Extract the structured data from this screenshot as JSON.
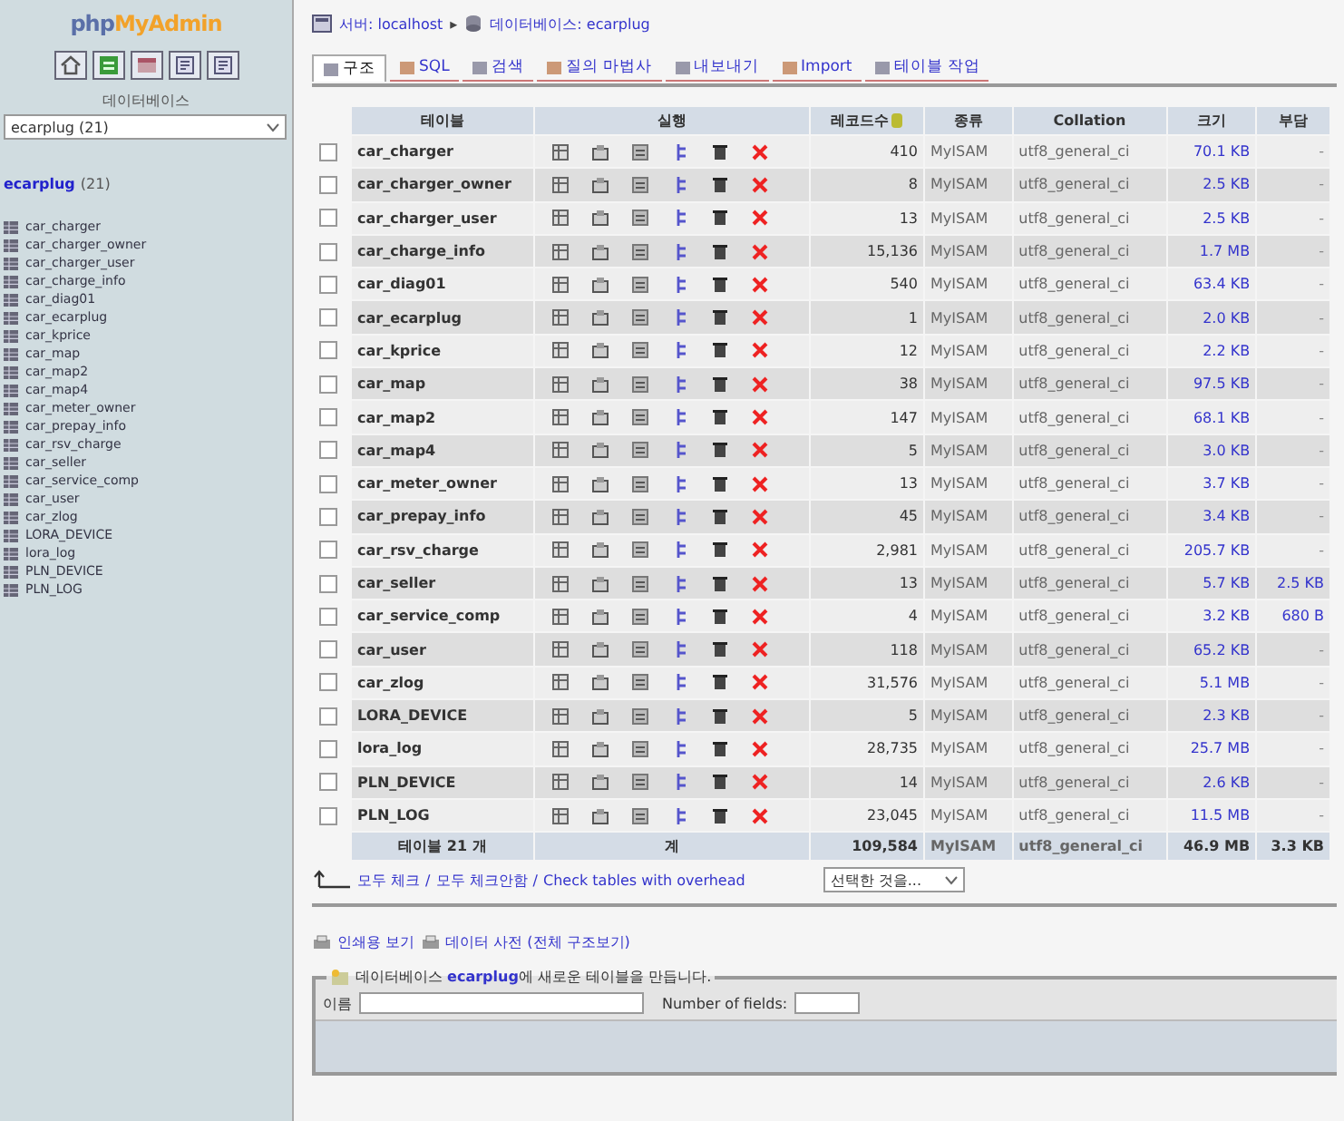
{
  "sidebar": {
    "logo_parts": [
      "php",
      "MyAdmin"
    ],
    "db_label": "데이터베이스",
    "db_select": "ecarplug (21)",
    "db_link": "ecarplug",
    "db_count": "(21)",
    "tables": [
      "car_charger",
      "car_charger_owner",
      "car_charger_user",
      "car_charge_info",
      "car_diag01",
      "car_ecarplug",
      "car_kprice",
      "car_map",
      "car_map2",
      "car_map4",
      "car_meter_owner",
      "car_prepay_info",
      "car_rsv_charge",
      "car_seller",
      "car_service_comp",
      "car_user",
      "car_zlog",
      "LORA_DEVICE",
      "lora_log",
      "PLN_DEVICE",
      "PLN_LOG"
    ]
  },
  "breadcrumb": {
    "server": "서버: localhost",
    "separator": "▸",
    "database": "데이터베이스: ecarplug"
  },
  "tabs": [
    {
      "label": "구조",
      "selected": true
    },
    {
      "label": "SQL",
      "selected": false
    },
    {
      "label": "검색",
      "selected": false
    },
    {
      "label": "질의 마법사",
      "selected": false
    },
    {
      "label": "내보내기",
      "selected": false
    },
    {
      "label": "Import",
      "selected": false
    },
    {
      "label": "테이블 작업",
      "selected": false
    }
  ],
  "table": {
    "columns": [
      "테이블",
      "실행",
      "레코드수",
      "종류",
      "Collation",
      "크기",
      "부담"
    ],
    "rows": [
      {
        "checked": false,
        "name": "car_charger",
        "records": "410",
        "type": "MyISAM",
        "collation": "utf8_general_ci",
        "size": "70.1 KB",
        "overhead": "-"
      },
      {
        "checked": false,
        "name": "car_charger_owner",
        "records": "8",
        "type": "MyISAM",
        "collation": "utf8_general_ci",
        "size": "2.5 KB",
        "overhead": "-"
      },
      {
        "checked": false,
        "name": "car_charger_user",
        "records": "13",
        "type": "MyISAM",
        "collation": "utf8_general_ci",
        "size": "2.5 KB",
        "overhead": "-"
      },
      {
        "checked": false,
        "name": "car_charge_info",
        "records": "15,136",
        "type": "MyISAM",
        "collation": "utf8_general_ci",
        "size": "1.7 MB",
        "overhead": "-"
      },
      {
        "checked": false,
        "name": "car_diag01",
        "records": "540",
        "type": "MyISAM",
        "collation": "utf8_general_ci",
        "size": "63.4 KB",
        "overhead": "-"
      },
      {
        "checked": false,
        "name": "car_ecarplug",
        "records": "1",
        "type": "MyISAM",
        "collation": "utf8_general_ci",
        "size": "2.0 KB",
        "overhead": "-"
      },
      {
        "checked": false,
        "name": "car_kprice",
        "records": "12",
        "type": "MyISAM",
        "collation": "utf8_general_ci",
        "size": "2.2 KB",
        "overhead": "-"
      },
      {
        "checked": false,
        "name": "car_map",
        "records": "38",
        "type": "MyISAM",
        "collation": "utf8_general_ci",
        "size": "97.5 KB",
        "overhead": "-"
      },
      {
        "checked": false,
        "name": "car_map2",
        "records": "147",
        "type": "MyISAM",
        "collation": "utf8_general_ci",
        "size": "68.1 KB",
        "overhead": "-"
      },
      {
        "checked": false,
        "name": "car_map4",
        "records": "5",
        "type": "MyISAM",
        "collation": "utf8_general_ci",
        "size": "3.0 KB",
        "overhead": "-"
      },
      {
        "checked": false,
        "name": "car_meter_owner",
        "records": "13",
        "type": "MyISAM",
        "collation": "utf8_general_ci",
        "size": "3.7 KB",
        "overhead": "-"
      },
      {
        "checked": false,
        "name": "car_prepay_info",
        "records": "45",
        "type": "MyISAM",
        "collation": "utf8_general_ci",
        "size": "3.4 KB",
        "overhead": "-"
      },
      {
        "checked": false,
        "name": "car_rsv_charge",
        "records": "2,981",
        "type": "MyISAM",
        "collation": "utf8_general_ci",
        "size": "205.7 KB",
        "overhead": "-"
      },
      {
        "checked": false,
        "name": "car_seller",
        "records": "13",
        "type": "MyISAM",
        "collation": "utf8_general_ci",
        "size": "5.7 KB",
        "overhead": "2.5 KB"
      },
      {
        "checked": false,
        "name": "car_service_comp",
        "records": "4",
        "type": "MyISAM",
        "collation": "utf8_general_ci",
        "size": "3.2 KB",
        "overhead": "680 B"
      },
      {
        "checked": false,
        "name": "car_user",
        "records": "118",
        "type": "MyISAM",
        "collation": "utf8_general_ci",
        "size": "65.2 KB",
        "overhead": "-"
      },
      {
        "checked": false,
        "name": "car_zlog",
        "records": "31,576",
        "type": "MyISAM",
        "collation": "utf8_general_ci",
        "size": "5.1 MB",
        "overhead": "-"
      },
      {
        "checked": false,
        "name": "LORA_DEVICE",
        "records": "5",
        "type": "MyISAM",
        "collation": "utf8_general_ci",
        "size": "2.3 KB",
        "overhead": "-"
      },
      {
        "checked": false,
        "name": "lora_log",
        "records": "28,735",
        "type": "MyISAM",
        "collation": "utf8_general_ci",
        "size": "25.7 MB",
        "overhead": "-"
      },
      {
        "checked": false,
        "name": "PLN_DEVICE",
        "records": "14",
        "type": "MyISAM",
        "collation": "utf8_general_ci",
        "size": "2.6 KB",
        "overhead": "-"
      },
      {
        "checked": false,
        "name": "PLN_LOG",
        "records": "23,045",
        "type": "MyISAM",
        "collation": "utf8_general_ci",
        "size": "11.5 MB",
        "overhead": "-"
      }
    ],
    "footer": {
      "count": "테이블 21 개",
      "sum_label": "계",
      "records": "109,584",
      "type": "MyISAM",
      "collation": "utf8_general_ci",
      "size": "46.9 MB",
      "overhead": "3.3 KB"
    }
  },
  "bulk": {
    "links": [
      "모두 체크",
      "모두 체크안함",
      "Check tables with overhead"
    ],
    "separator": "/",
    "action_select": "선택한 것을..."
  },
  "extra_links": [
    "인쇄용 보기",
    "데이터 사전 (전체 구조보기)"
  ],
  "create_table": {
    "legend_before": "데이터베이스 ",
    "legend_db": "ecarplug",
    "legend_after": "에 새로운 테이블을 만듭니다.",
    "name_label": "이름",
    "fields_label": "Number of fields:"
  }
}
